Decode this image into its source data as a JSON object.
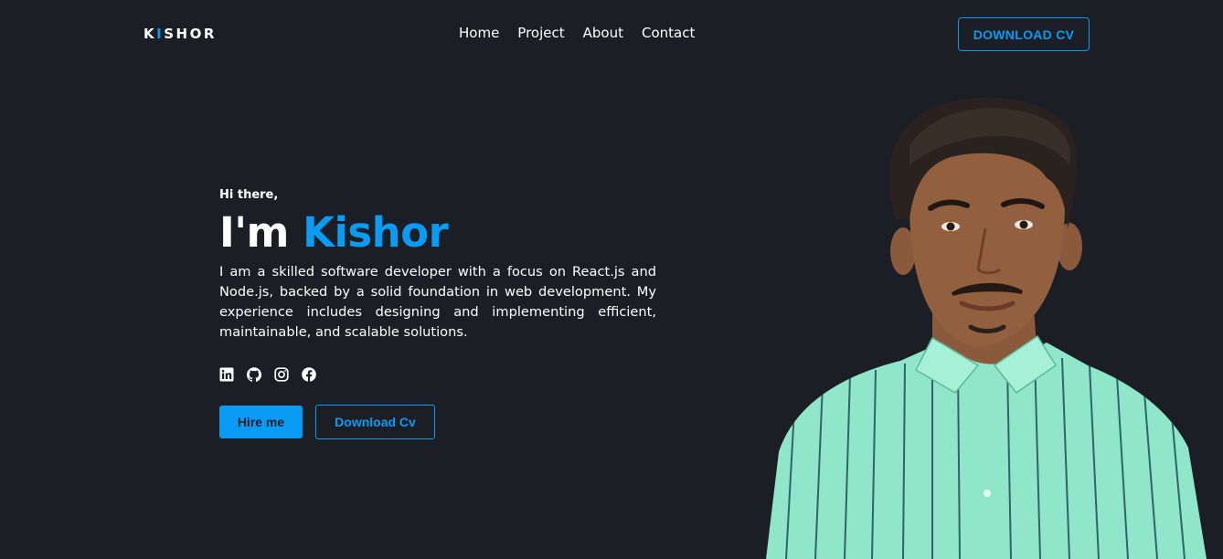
{
  "nav": {
    "logo_first": "K",
    "logo_accent": "I",
    "logo_rest": "SHOR",
    "links": [
      "Home",
      "Project",
      "About",
      "Contact"
    ],
    "download_label": "DOWNLOAD CV"
  },
  "hero": {
    "greeting": "Hi there,",
    "headline_prefix": "I'm ",
    "headline_name": "Kishor",
    "bio": "I am a skilled software developer with a focus on React.js and Node.js, backed by a solid foundation in web development. My experience includes designing and implementing efficient, maintainable, and scalable solutions.",
    "socials": [
      "linkedin-icon",
      "github-icon",
      "instagram-icon",
      "facebook-icon"
    ],
    "hire_label": "Hire me",
    "download_label": "Download Cv"
  },
  "colors": {
    "background": "#1b1e25",
    "accent": "#0a9bf5",
    "text": "#ffffff"
  }
}
